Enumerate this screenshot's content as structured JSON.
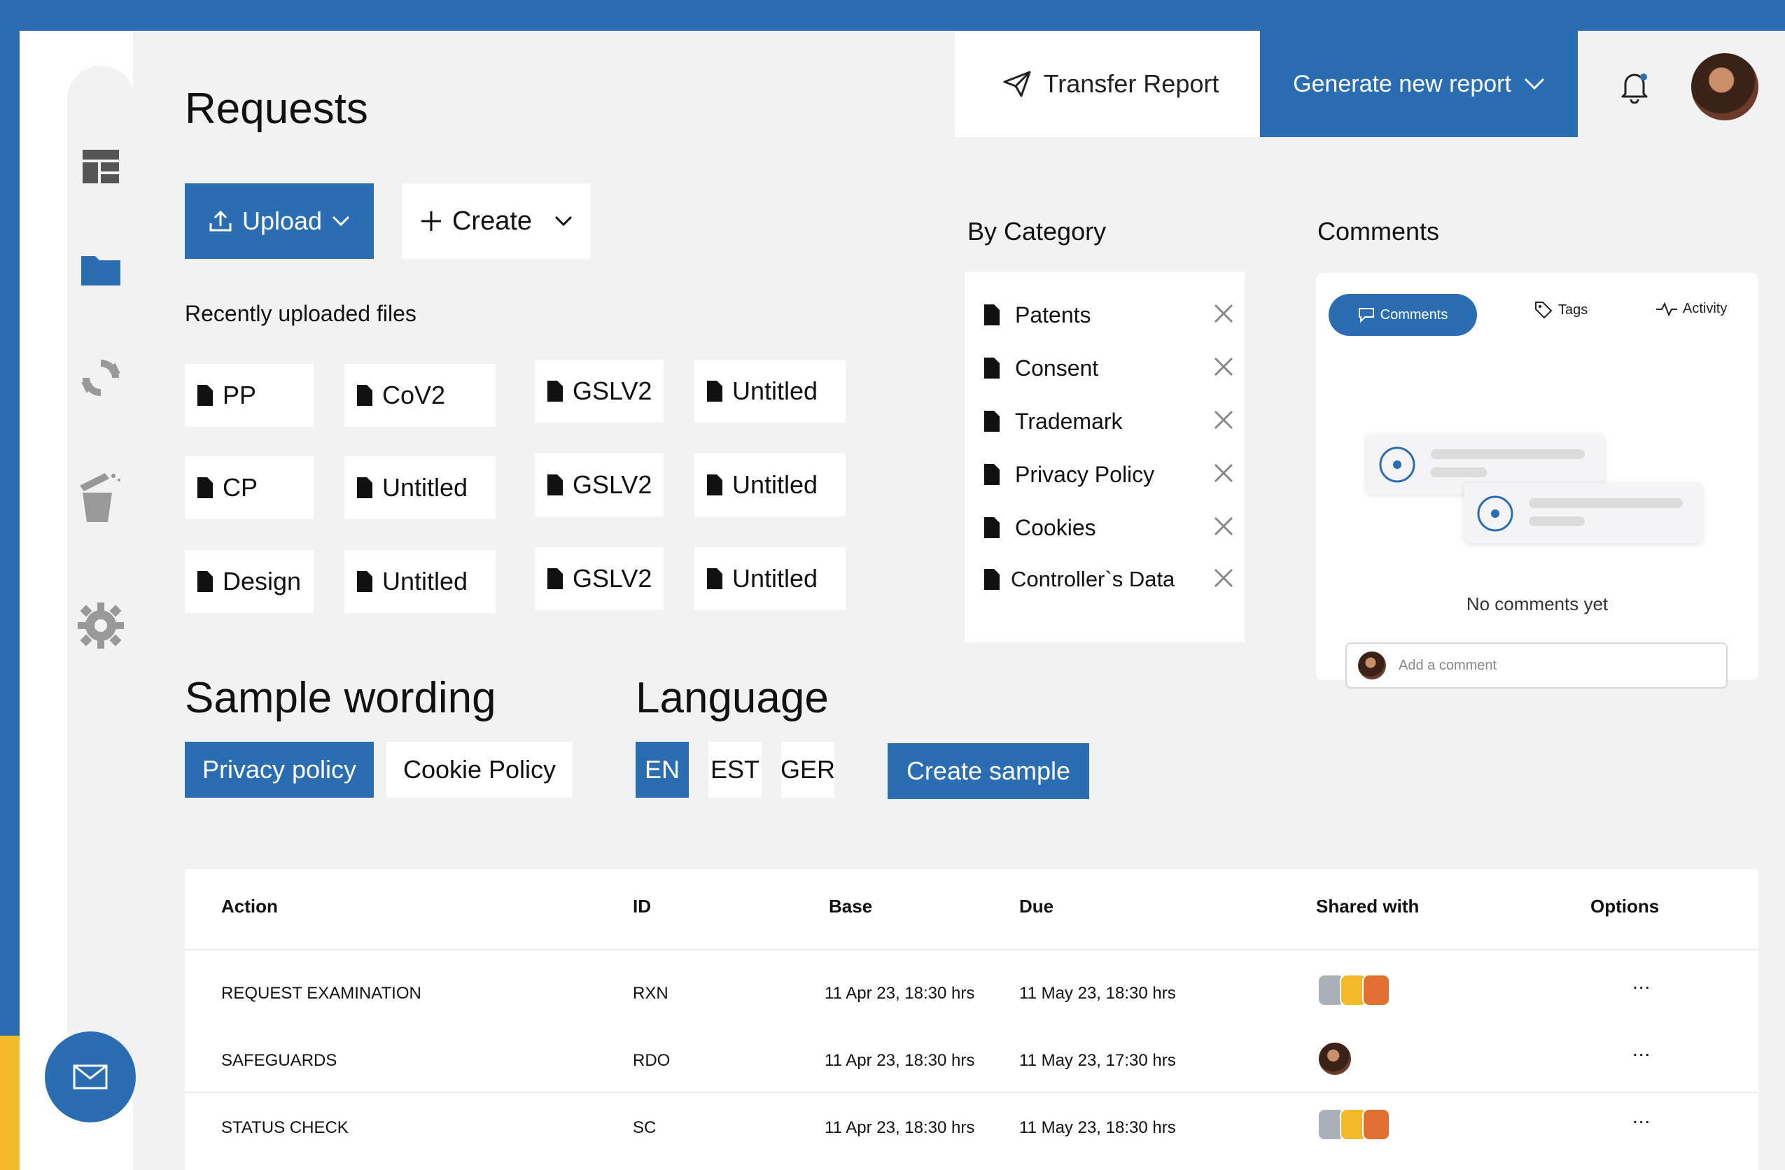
{
  "header": {
    "page_title": "Requests",
    "transfer_label": "Transfer Report",
    "generate_label": "Generate new report"
  },
  "toolbar": {
    "upload_label": "Upload",
    "create_label": "Create"
  },
  "recent": {
    "label": "Recently uploaded files",
    "files": [
      "PP",
      "CoV2",
      "GSLV2",
      "Untitled",
      "CP",
      "Untitled",
      "GSLV2",
      "Untitled",
      "Design",
      "Untitled",
      "GSLV2",
      "Untitled"
    ]
  },
  "category": {
    "label": "By Category",
    "items": [
      "Patents",
      "Consent",
      "Trademark",
      "Privacy Policy",
      "Cookies",
      "Controller`s Data"
    ]
  },
  "comments": {
    "label": "Comments",
    "tabs": [
      "Comments",
      "Tags",
      "Activity"
    ],
    "empty_text": "No comments yet",
    "input_placeholder": "Add a comment"
  },
  "sample": {
    "heading": "Sample wording",
    "options": [
      "Privacy policy",
      "Cookie Policy"
    ]
  },
  "language": {
    "heading": "Language",
    "options": [
      "EN",
      "EST",
      "GER"
    ],
    "create_label": "Create sample"
  },
  "table": {
    "headers": [
      "Action",
      "ID",
      "Base",
      "Due",
      "Shared with",
      "Options"
    ],
    "rows": [
      {
        "action": "REQUEST EXAMINATION",
        "id": "RXN",
        "base": "11 Apr 23, 18:30 hrs",
        "due": "11 May 23, 18:30 hrs",
        "options": "..."
      },
      {
        "action": "SAFEGUARDS",
        "id": "RDO",
        "base": "11 Apr 23, 18:30 hrs",
        "due": "11 May 23, 17:30 hrs",
        "options": "..."
      },
      {
        "action": "STATUS CHECK",
        "id": "SC",
        "base": "11 Apr 23, 18:30 hrs",
        "due": "11 May 23, 18:30 hrs",
        "options": "..."
      }
    ]
  },
  "colors": {
    "brand_blue": "#2a6db2",
    "accent_yellow": "#f2b928",
    "background": "#f2f2f2"
  },
  "icons": {
    "sidebar": [
      "dashboard-icon",
      "folder-icon",
      "sync-icon",
      "trash-icon",
      "gear-icon"
    ],
    "fab": "mail-icon"
  }
}
